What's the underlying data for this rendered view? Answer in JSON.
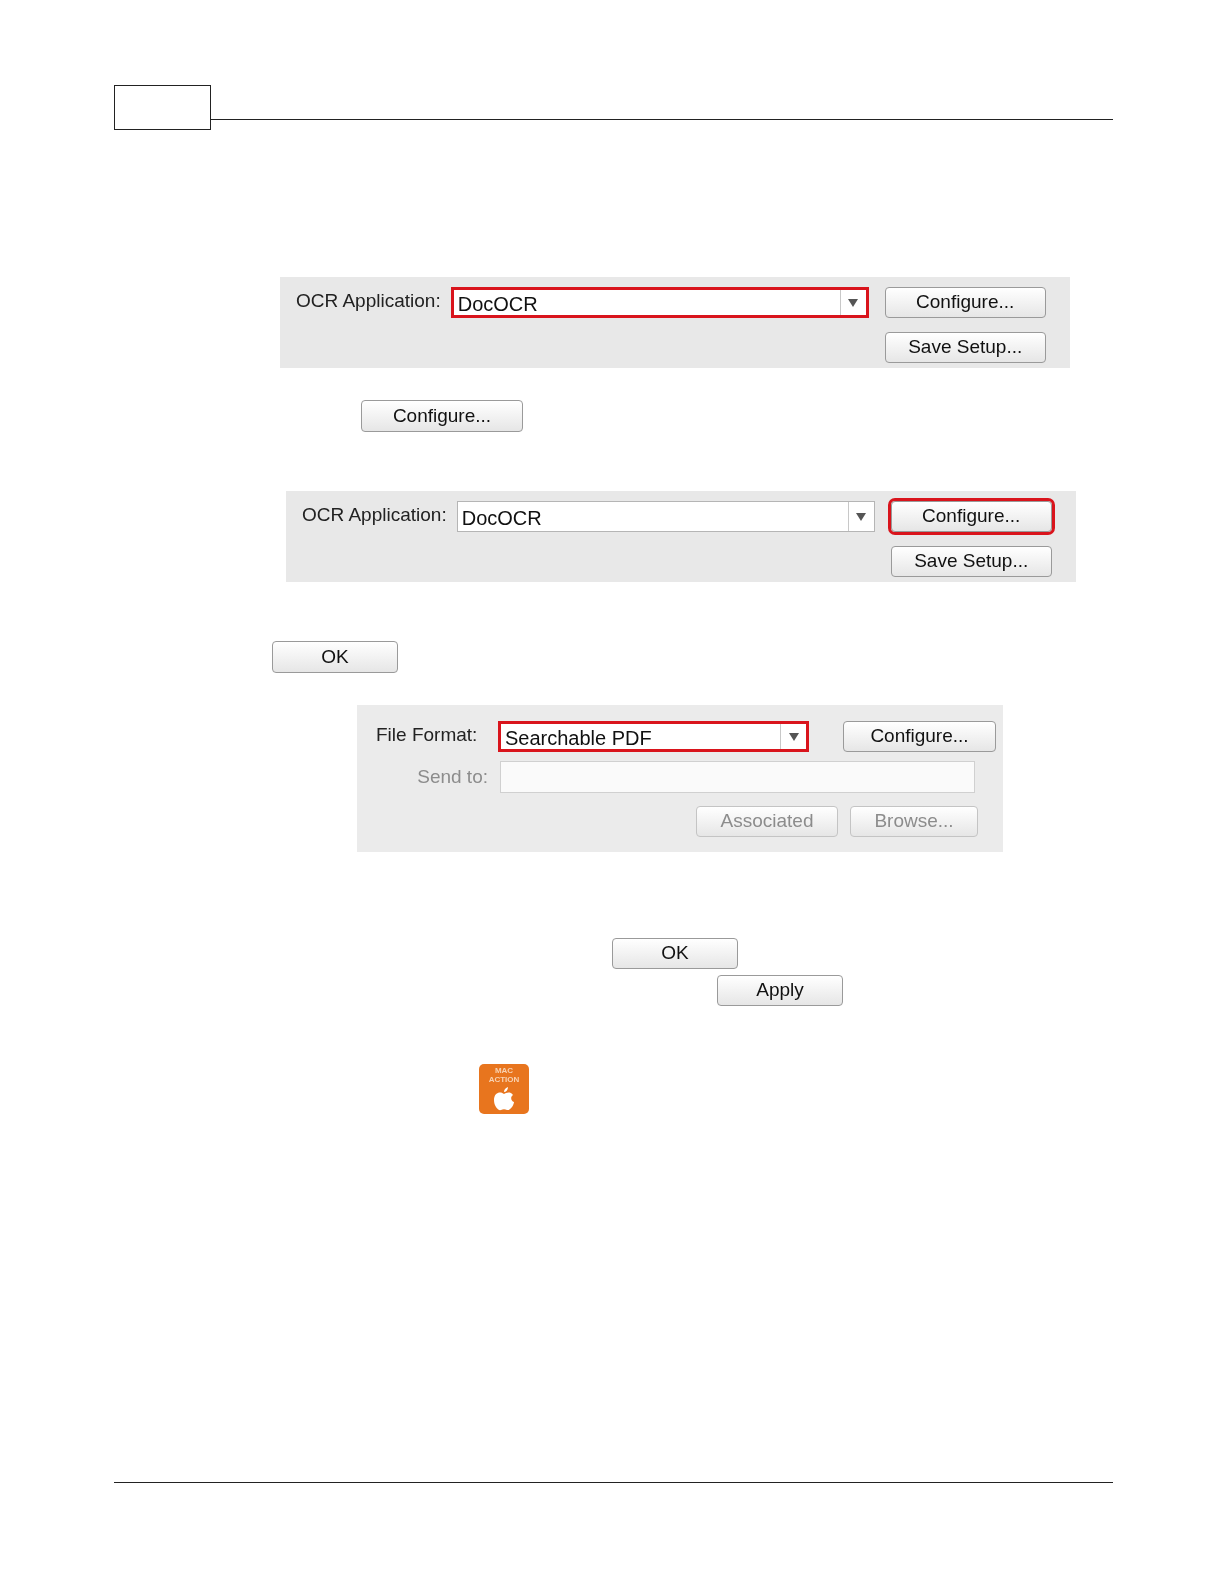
{
  "ocr_panel_1": {
    "label": "OCR Application:",
    "dropdown": {
      "value": "DocOCR",
      "highlighted": true
    },
    "buttons": [
      {
        "label": "Configure...",
        "highlighted": false
      },
      {
        "label": "Save Setup...",
        "highlighted": false
      }
    ]
  },
  "configure_button": {
    "label": "Configure..."
  },
  "ocr_panel_2": {
    "label": "OCR Application:",
    "dropdown": {
      "value": "DocOCR",
      "highlighted": false
    },
    "buttons": [
      {
        "label": "Configure...",
        "highlighted": true
      },
      {
        "label": "Save Setup...",
        "highlighted": false
      }
    ]
  },
  "ok_button_1": {
    "label": "OK"
  },
  "format_panel": {
    "file_format_label": "File Format:",
    "dropdown": {
      "value": "Searchable PDF",
      "highlighted": true
    },
    "configure": {
      "label": "Configure...",
      "disabled": false
    },
    "send_to_label": "Send to:",
    "send_to_disabled": true,
    "buttons": [
      {
        "label": "Associated",
        "disabled": true
      },
      {
        "label": "Browse...",
        "disabled": true
      }
    ]
  },
  "ok_button_2": {
    "label": "OK"
  },
  "apply_button": {
    "label": "Apply"
  },
  "mac_action_badge": {
    "line_1": "MAC",
    "line_2": "ACTION"
  }
}
